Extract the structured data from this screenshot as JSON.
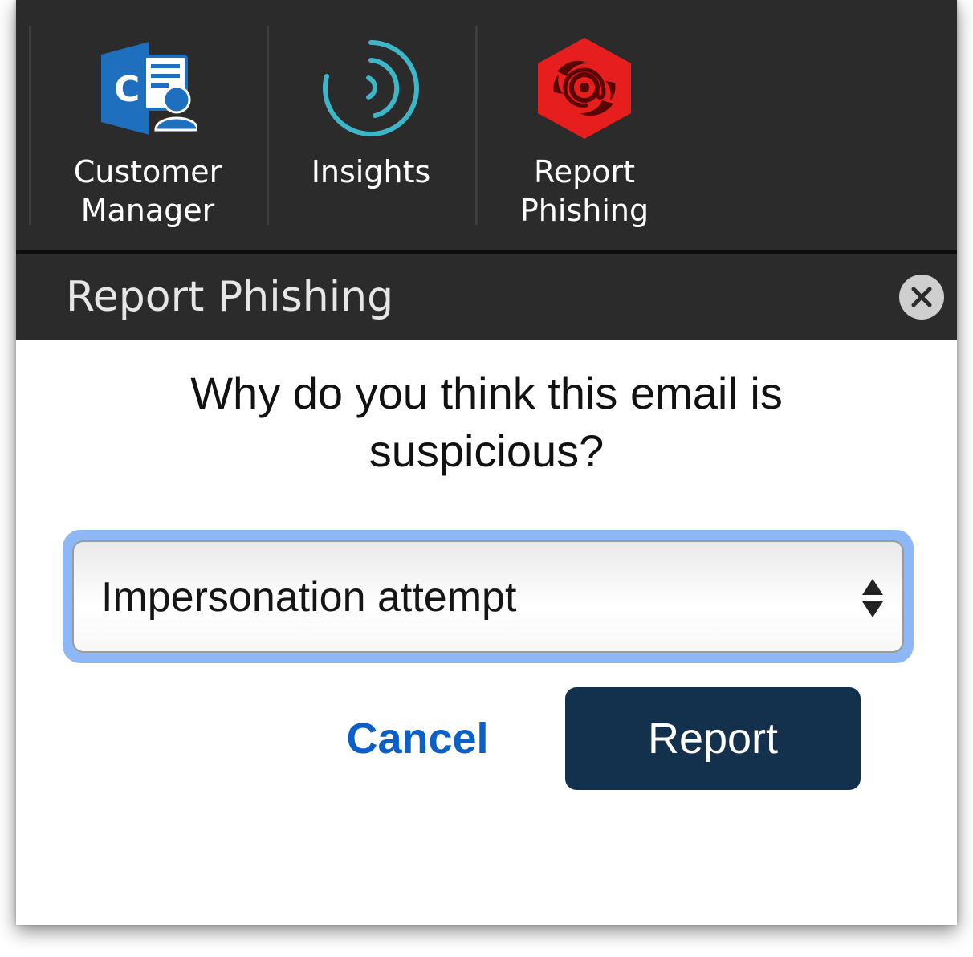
{
  "ribbon": {
    "buttons": [
      {
        "line1": "Customer",
        "line2": "Manager",
        "icon": "customer-manager-icon",
        "color": "#1f6fbf"
      },
      {
        "line1": "Insights",
        "line2": "",
        "icon": "insights-icon",
        "color": "#3db6c8"
      },
      {
        "line1": "Report",
        "line2": "Phishing",
        "icon": "report-phishing-icon",
        "color": "#e61e1e"
      }
    ]
  },
  "pane": {
    "title": "Report Phishing",
    "close_icon": "close-icon"
  },
  "form": {
    "question": "Why do you think this email is suspicious?",
    "reason_select": {
      "value": "Impersonation attempt"
    },
    "cancel_label": "Cancel",
    "report_label": "Report"
  },
  "colors": {
    "ribbon_bg": "#2b2b2b",
    "focus_ring": "#8db7f5",
    "cancel_link": "#0a5fc9",
    "report_button": "#13304c"
  }
}
